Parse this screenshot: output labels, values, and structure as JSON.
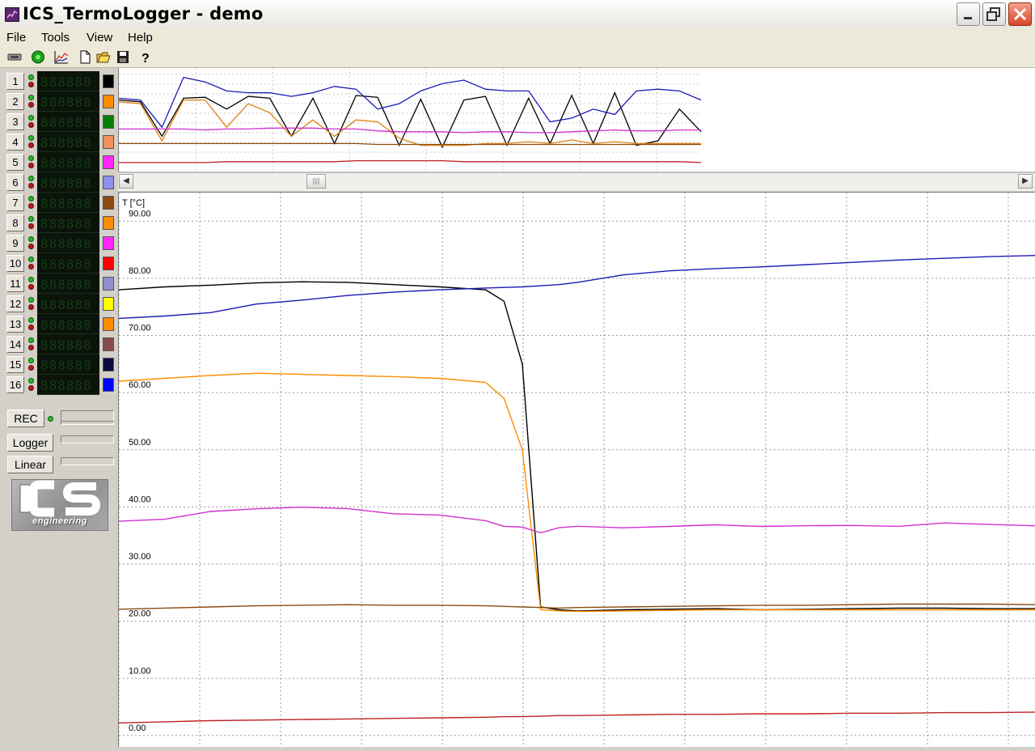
{
  "window": {
    "title": "ICS_TermoLogger - demo"
  },
  "menu": {
    "items": [
      "File",
      "Tools",
      "View",
      "Help"
    ]
  },
  "toolbar": {
    "buttons": [
      "device-icon",
      "connect-icon",
      "chart-icon",
      "new-file-icon",
      "open-folder-icon",
      "save-icon",
      "help-icon"
    ]
  },
  "channels": [
    {
      "num": "1",
      "color": "#000000"
    },
    {
      "num": "2",
      "color": "#ff8c00"
    },
    {
      "num": "3",
      "color": "#008000"
    },
    {
      "num": "4",
      "color": "#f4905a"
    },
    {
      "num": "5",
      "color": "#ff28ff"
    },
    {
      "num": "6",
      "color": "#9090ee"
    },
    {
      "num": "7",
      "color": "#8b4a10"
    },
    {
      "num": "8",
      "color": "#ff8c00"
    },
    {
      "num": "9",
      "color": "#ff28ff"
    },
    {
      "num": "10",
      "color": "#ff0000"
    },
    {
      "num": "11",
      "color": "#9090d0"
    },
    {
      "num": "12",
      "color": "#ffff00"
    },
    {
      "num": "13",
      "color": "#ff8c00"
    },
    {
      "num": "14",
      "color": "#8b4a4a"
    },
    {
      "num": "15",
      "color": "#0a0a40"
    },
    {
      "num": "16",
      "color": "#0000ff"
    }
  ],
  "controls": {
    "rec": "REC",
    "logger": "Logger",
    "linear": "Linear"
  },
  "chart": {
    "ylabel": "T [°C]",
    "yticks": [
      "90.00",
      "80.00",
      "70.00",
      "60.00",
      "50.00",
      "40.00",
      "30.00",
      "20.00",
      "10.00",
      "0.00"
    ]
  },
  "chart_data": {
    "type": "line",
    "ylabel": "T [°C]",
    "ylim": [
      -2,
      95
    ],
    "grid": true,
    "legend": "none",
    "x": [
      0,
      5,
      10,
      15,
      20,
      25,
      30,
      35,
      40,
      42,
      44,
      46,
      48,
      50,
      55,
      60,
      65,
      70,
      75,
      80,
      85,
      90,
      95,
      100
    ],
    "series": [
      {
        "color": "#000000",
        "values": [
          78,
          78.5,
          78.8,
          79.2,
          79.4,
          79.3,
          78.9,
          78.5,
          78,
          76,
          65,
          22.5,
          22,
          21.8,
          22,
          22.1,
          22.2,
          22,
          22.1,
          22.2,
          22.3,
          22.3,
          22.2,
          22.2
        ]
      },
      {
        "color": "#ff8c00",
        "values": [
          62,
          62.5,
          63,
          63.4,
          63.2,
          63,
          62.8,
          62.5,
          61.8,
          59,
          50,
          22,
          21.8,
          21.7,
          21.8,
          21.9,
          22,
          22,
          22,
          22,
          22,
          22,
          22,
          22
        ]
      },
      {
        "color": "#1a1ab4",
        "values": [
          73,
          73.4,
          74,
          75.5,
          76.2,
          77,
          77.6,
          78,
          78.3,
          78.4,
          78.5,
          78.7,
          78.9,
          79.3,
          80.6,
          81.3,
          81.7,
          82,
          82.4,
          82.8,
          83.2,
          83.5,
          83.8,
          84
        ]
      },
      {
        "color": "#d030d0",
        "values": [
          37.5,
          38,
          39,
          39.8,
          40,
          39.5,
          39,
          38.5,
          37.5,
          36.8,
          36.3,
          35.5,
          36.5,
          36.4,
          36.5,
          36.6,
          36.7,
          36.8,
          36.6,
          36.7,
          36.8,
          37,
          37,
          36.8
        ]
      },
      {
        "color": "#8b4a10",
        "values": [
          22.1,
          22.3,
          22.5,
          22.7,
          22.8,
          22.9,
          22.8,
          22.8,
          22.7,
          22.6,
          22.5,
          22.4,
          22.3,
          22.4,
          22.5,
          22.6,
          22.7,
          22.8,
          22.8,
          22.9,
          23,
          23,
          23,
          22.9
        ]
      },
      {
        "color": "#c02020",
        "values": [
          2.2,
          2.4,
          2.6,
          2.7,
          2.8,
          2.9,
          3,
          3.1,
          3.2,
          3.3,
          3.3,
          3.4,
          3.5,
          3.5,
          3.6,
          3.7,
          3.7,
          3.8,
          3.8,
          3.9,
          3.9,
          4,
          4,
          4.1
        ]
      }
    ]
  },
  "overview": {
    "ylim": [
      0,
      100
    ],
    "series": [
      {
        "color": "#000000",
        "values": [
          70,
          68,
          30,
          72,
          73,
          60,
          74,
          72,
          30,
          72,
          22,
          75,
          73,
          20,
          71,
          18,
          70,
          74,
          20,
          72,
          22,
          75,
          22,
          78,
          20,
          25,
          60,
          35
        ]
      },
      {
        "color": "#e08010",
        "values": [
          68,
          66,
          25,
          70,
          70,
          40,
          66,
          56,
          30,
          48,
          30,
          48,
          46,
          28,
          20,
          20,
          20,
          22,
          22,
          24,
          22,
          26,
          22,
          24,
          22,
          22,
          22,
          22
        ]
      },
      {
        "color": "#1a1ab4",
        "values": [
          72,
          70,
          40,
          95,
          90,
          80,
          78,
          78,
          74,
          78,
          85,
          82,
          60,
          66,
          80,
          88,
          92,
          82,
          80,
          80,
          46,
          50,
          60,
          54,
          80,
          82,
          80,
          70
        ]
      },
      {
        "color": "#d030d0",
        "values": [
          38,
          38,
          38,
          38,
          37,
          38,
          38,
          39,
          39,
          39,
          38,
          38,
          36,
          35,
          35,
          35,
          34,
          35,
          35,
          34,
          34,
          35,
          36,
          37,
          36,
          36,
          37,
          37
        ]
      },
      {
        "color": "#8b4a10",
        "values": [
          22,
          22,
          22,
          22,
          22,
          22,
          22,
          22,
          22,
          22,
          22,
          22,
          21,
          21,
          21,
          21,
          21,
          21,
          21,
          21,
          21,
          21,
          21,
          21,
          21,
          21,
          21,
          21
        ]
      },
      {
        "color": "#c02020",
        "values": [
          1,
          1,
          1,
          1,
          1,
          2,
          2,
          2,
          2,
          2,
          2,
          3,
          3,
          3,
          3,
          3,
          2,
          2,
          2,
          2,
          2,
          2,
          2,
          2,
          2,
          2,
          2,
          1
        ]
      }
    ]
  }
}
